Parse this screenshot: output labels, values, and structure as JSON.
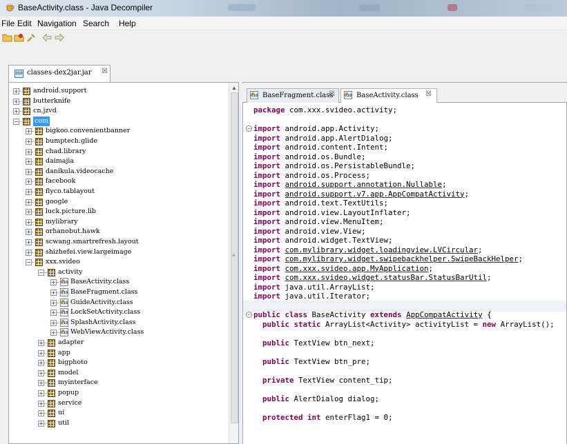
{
  "window": {
    "title": "BaseActivity.class - Java Decompiler"
  },
  "menu": [
    "File",
    "Edit",
    "Navigation",
    "Search",
    "Help"
  ],
  "left_tab": {
    "label": "classes-dex2jar.jar",
    "close": "☒"
  },
  "tree": [
    {
      "level": 0,
      "expander": "+",
      "icon": "pkg",
      "label": "android.support"
    },
    {
      "level": 0,
      "expander": "+",
      "icon": "pkg",
      "label": "butterknife"
    },
    {
      "level": 0,
      "expander": "+",
      "icon": "pkg",
      "label": "cn.jzvd"
    },
    {
      "level": 0,
      "expander": "−",
      "icon": "pkg",
      "label": "com",
      "selected": true
    },
    {
      "level": 1,
      "expander": "+",
      "icon": "pkg",
      "label": "bigkoo.convenientbanner"
    },
    {
      "level": 1,
      "expander": "+",
      "icon": "pkg",
      "label": "bumptech.glide"
    },
    {
      "level": 1,
      "expander": "+",
      "icon": "pkg",
      "label": "chad.library"
    },
    {
      "level": 1,
      "expander": "+",
      "icon": "pkg",
      "label": "daimajia"
    },
    {
      "level": 1,
      "expander": "+",
      "icon": "pkg",
      "label": "danikula.videocache"
    },
    {
      "level": 1,
      "expander": "+",
      "icon": "pkg",
      "label": "facebook"
    },
    {
      "level": 1,
      "expander": "+",
      "icon": "pkg",
      "label": "flyco.tablayout"
    },
    {
      "level": 1,
      "expander": "+",
      "icon": "pkg",
      "label": "google"
    },
    {
      "level": 1,
      "expander": "+",
      "icon": "pkg",
      "label": "luck.picture.lib"
    },
    {
      "level": 1,
      "expander": "+",
      "icon": "pkg",
      "label": "mylibrary"
    },
    {
      "level": 1,
      "expander": "+",
      "icon": "pkg",
      "label": "orhanobut.hawk"
    },
    {
      "level": 1,
      "expander": "+",
      "icon": "pkg",
      "label": "scwang.smartrefresh.layout"
    },
    {
      "level": 1,
      "expander": "+",
      "icon": "pkg",
      "label": "shizhefei.view.largeimage"
    },
    {
      "level": 1,
      "expander": "−",
      "icon": "pkg",
      "label": "xxx.svideo"
    },
    {
      "level": 2,
      "expander": "−",
      "icon": "pkg",
      "label": "activity"
    },
    {
      "level": 3,
      "expander": "+",
      "icon": "cls",
      "label": "BaseActivity.class"
    },
    {
      "level": 3,
      "expander": "+",
      "icon": "cls",
      "label": "BaseFragment.class"
    },
    {
      "level": 3,
      "expander": "+",
      "icon": "cls",
      "label": "GuideActivity.class"
    },
    {
      "level": 3,
      "expander": "+",
      "icon": "cls",
      "label": "LockSetActivity.class"
    },
    {
      "level": 3,
      "expander": "+",
      "icon": "cls",
      "label": "SplashActivity.class"
    },
    {
      "level": 3,
      "expander": "+",
      "icon": "cls",
      "label": "WebViewActivity.class"
    },
    {
      "level": 2,
      "expander": "+",
      "icon": "pkg",
      "label": "adapter"
    },
    {
      "level": 2,
      "expander": "+",
      "icon": "pkg",
      "label": "app"
    },
    {
      "level": 2,
      "expander": "+",
      "icon": "pkg",
      "label": "bigphoto"
    },
    {
      "level": 2,
      "expander": "+",
      "icon": "pkg",
      "label": "model"
    },
    {
      "level": 2,
      "expander": "+",
      "icon": "pkg",
      "label": "myinterface"
    },
    {
      "level": 2,
      "expander": "+",
      "icon": "pkg",
      "label": "popup"
    },
    {
      "level": 2,
      "expander": "+",
      "icon": "pkg",
      "label": "service"
    },
    {
      "level": 2,
      "expander": "+",
      "icon": "pkg",
      "label": "ui"
    },
    {
      "level": 2,
      "expander": "+",
      "icon": "pkg",
      "label": "util"
    }
  ],
  "editor_tabs": [
    {
      "label": "BaseFragment.class",
      "close": "☒",
      "active": false
    },
    {
      "label": "BaseActivity.class",
      "close": "☒",
      "active": true
    }
  ],
  "code": [
    {
      "fold": "",
      "parts": [
        {
          "t": "package",
          "k": "kw"
        },
        {
          "t": " com.xxx.svideo.activity;"
        }
      ]
    },
    {
      "fold": "",
      "parts": []
    },
    {
      "fold": "⊖",
      "parts": [
        {
          "t": "import",
          "k": "kw"
        },
        {
          "t": " android.app.Activity;"
        }
      ]
    },
    {
      "fold": "",
      "parts": [
        {
          "t": "import",
          "k": "kw"
        },
        {
          "t": " android.app.AlertDialog;"
        }
      ]
    },
    {
      "fold": "",
      "parts": [
        {
          "t": "import",
          "k": "kw"
        },
        {
          "t": " android.content.Intent;"
        }
      ]
    },
    {
      "fold": "",
      "parts": [
        {
          "t": "import",
          "k": "kw"
        },
        {
          "t": " android.os.Bundle;"
        }
      ]
    },
    {
      "fold": "",
      "parts": [
        {
          "t": "import",
          "k": "kw"
        },
        {
          "t": " android.os.PersistableBundle;"
        }
      ]
    },
    {
      "fold": "",
      "parts": [
        {
          "t": "import",
          "k": "kw"
        },
        {
          "t": " android.os.Process;"
        }
      ]
    },
    {
      "fold": "",
      "parts": [
        {
          "t": "import",
          "k": "kw"
        },
        {
          "t": " "
        },
        {
          "t": "android.support.annotation.Nullable",
          "k": "ul"
        },
        {
          "t": ";"
        }
      ]
    },
    {
      "fold": "",
      "parts": [
        {
          "t": "import",
          "k": "kw"
        },
        {
          "t": " "
        },
        {
          "t": "android.support.v7.app.AppCompatActivity",
          "k": "ul"
        },
        {
          "t": ";"
        }
      ]
    },
    {
      "fold": "",
      "parts": [
        {
          "t": "import",
          "k": "kw"
        },
        {
          "t": " android.text.TextUtils;"
        }
      ]
    },
    {
      "fold": "",
      "parts": [
        {
          "t": "import",
          "k": "kw"
        },
        {
          "t": " android.view.LayoutInflater;"
        }
      ]
    },
    {
      "fold": "",
      "parts": [
        {
          "t": "import",
          "k": "kw"
        },
        {
          "t": " android.view.MenuItem;"
        }
      ]
    },
    {
      "fold": "",
      "parts": [
        {
          "t": "import",
          "k": "kw"
        },
        {
          "t": " android.view.View;"
        }
      ]
    },
    {
      "fold": "",
      "parts": [
        {
          "t": "import",
          "k": "kw"
        },
        {
          "t": " android.widget.TextView;"
        }
      ]
    },
    {
      "fold": "",
      "parts": [
        {
          "t": "import",
          "k": "kw"
        },
        {
          "t": " "
        },
        {
          "t": "com.mylibrary.widget.loadingview.LVCircular",
          "k": "ul"
        },
        {
          "t": ";"
        }
      ]
    },
    {
      "fold": "",
      "parts": [
        {
          "t": "import",
          "k": "kw"
        },
        {
          "t": " "
        },
        {
          "t": "com.mylibrary.widget.swipebackhelper.SwipeBackHelper",
          "k": "ul"
        },
        {
          "t": ";"
        }
      ]
    },
    {
      "fold": "",
      "parts": [
        {
          "t": "import",
          "k": "kw"
        },
        {
          "t": " "
        },
        {
          "t": "com.xxx.svideo.app.MyApplication",
          "k": "ul"
        },
        {
          "t": ";"
        }
      ]
    },
    {
      "fold": "",
      "parts": [
        {
          "t": "import",
          "k": "kw"
        },
        {
          "t": " "
        },
        {
          "t": "com.xxx.svideo.widget.statusBar.StatusBarUtil",
          "k": "ul"
        },
        {
          "t": ";"
        }
      ]
    },
    {
      "fold": "",
      "parts": [
        {
          "t": "import",
          "k": "kw"
        },
        {
          "t": " java.util.ArrayList;"
        }
      ]
    },
    {
      "fold": "",
      "parts": [
        {
          "t": "import",
          "k": "kw"
        },
        {
          "t": " java.util.Iterator;"
        }
      ]
    },
    {
      "fold": "",
      "parts": []
    },
    {
      "fold": "⊖",
      "parts": [
        {
          "t": "public class",
          "k": "kw"
        },
        {
          "t": " BaseActivity "
        },
        {
          "t": "extends",
          "k": "kw"
        },
        {
          "t": " "
        },
        {
          "t": "AppCompatActivity",
          "k": "ul"
        },
        {
          "t": " {"
        }
      ]
    },
    {
      "fold": "",
      "parts": [
        {
          "t": "  "
        },
        {
          "t": "public static",
          "k": "kw"
        },
        {
          "t": " ArrayList<Activity> activityList = "
        },
        {
          "t": "new",
          "k": "kw"
        },
        {
          "t": " ArrayList();"
        }
      ]
    },
    {
      "fold": "",
      "parts": []
    },
    {
      "fold": "",
      "parts": [
        {
          "t": "  "
        },
        {
          "t": "public",
          "k": "kw"
        },
        {
          "t": " TextView btn_next;"
        }
      ]
    },
    {
      "fold": "",
      "parts": []
    },
    {
      "fold": "",
      "parts": [
        {
          "t": "  "
        },
        {
          "t": "public",
          "k": "kw"
        },
        {
          "t": " TextView btn_pre;"
        }
      ]
    },
    {
      "fold": "",
      "parts": []
    },
    {
      "fold": "",
      "parts": [
        {
          "t": "  "
        },
        {
          "t": "private",
          "k": "kw"
        },
        {
          "t": " TextView content_tip;"
        }
      ]
    },
    {
      "fold": "",
      "parts": []
    },
    {
      "fold": "",
      "parts": [
        {
          "t": "  "
        },
        {
          "t": "public",
          "k": "kw"
        },
        {
          "t": " AlertDialog dialog;"
        }
      ]
    },
    {
      "fold": "",
      "parts": []
    },
    {
      "fold": "",
      "parts": [
        {
          "t": "  "
        },
        {
          "t": "protected int",
          "k": "kw"
        },
        {
          "t": " enterFlag1 = 0;"
        }
      ]
    }
  ],
  "colors": {
    "keyword": "#7f0055",
    "selection": "#3399ff",
    "package_icon": "#9a6a1a"
  }
}
